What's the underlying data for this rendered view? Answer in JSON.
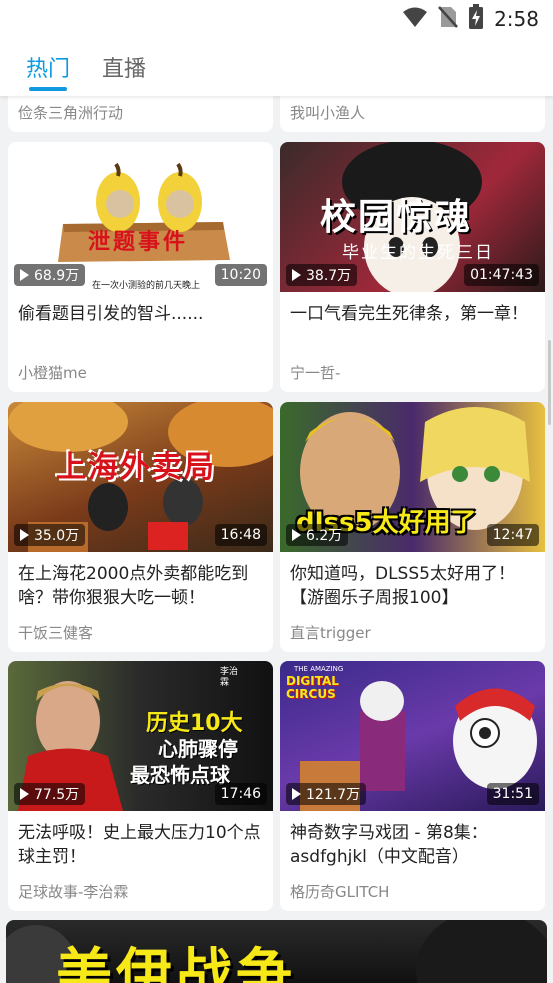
{
  "status": {
    "time": "2:58",
    "icons": [
      "wifi-icon",
      "no-sim-icon",
      "battery-charging-icon"
    ]
  },
  "tabs": [
    {
      "label": "热门",
      "active": true
    },
    {
      "label": "直播",
      "active": false
    }
  ],
  "colors": {
    "accent": "#0f9adf",
    "text": "#222222",
    "secondary": "#888888",
    "background": "#f1f2f3"
  },
  "partial_top": {
    "left_author": "俭条三角洲行动",
    "right_author": "我叫小渔人"
  },
  "videos": [
    {
      "views": "68.9万",
      "duration": "10:20",
      "title": "偷看题目引发的智斗......",
      "author": "小橙猫me",
      "thumb_text": "泄题事件",
      "thumb_subtext": "在一次小测验的前几天晚上"
    },
    {
      "views": "38.7万",
      "duration": "01:47:43",
      "title": "一口气看完生死律条，第一章！",
      "author": "宁一哲-",
      "thumb_text": "校园惊魂",
      "thumb_subtext": "毕业生的生死三日"
    },
    {
      "views": "35.0万",
      "duration": "16:48",
      "title": "在上海花2000点外卖都能吃到啥？带你狠狠大吃一顿！",
      "author": "干饭三健客",
      "thumb_text": "上海外卖局"
    },
    {
      "views": "6.2万",
      "duration": "12:47",
      "title": "你知道吗，DLSS5太好用了！【游圈乐子周报100】",
      "author": "直言trigger",
      "thumb_text": "dlss5太好用了"
    },
    {
      "views": "77.5万",
      "duration": "17:46",
      "title": "无法呼吸！史上最大压力10个点球主罚！",
      "author": "足球故事-李治霖",
      "thumb_text": "历史10大",
      "thumb_text2": "心肺骤停",
      "thumb_text3": "最恐怖点球",
      "thumb_badge": "李治霖"
    },
    {
      "views": "121.7万",
      "duration": "31:51",
      "title": "神奇数字马戏团 - 第8集：asdfghjkl（中文配音）",
      "author": "格历奇GLITCH",
      "thumb_logo": "DIGITAL CIRCUS",
      "thumb_logo_top": "THE AMAZING"
    }
  ],
  "bottom_banner": {
    "text": "美伊战争"
  }
}
